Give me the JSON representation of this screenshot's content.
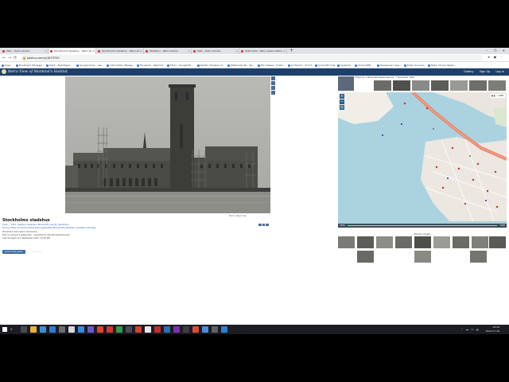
{
  "browser": {
    "tabs": [
      {
        "label": "Main - Retro photos"
      },
      {
        "label": "Stockholms stadshus - Retro ph..."
      },
      {
        "label": "Stockholms stadshus - Retro ph..."
      },
      {
        "label": "Stadshus - Retro photos"
      },
      {
        "label": "Main - Retro photos"
      },
      {
        "label": "Wikimedia - Retro pastvu Retro..."
      }
    ],
    "new_tab_symbol": "+",
    "window_controls": "– ❐ ✕",
    "url": "pastvu.com/p/1673709",
    "back_symbol": "←",
    "forward_symbol": "→",
    "reload_symbol": "⟳",
    "bookmarks": [
      {
        "label": "Apps"
      },
      {
        "label": "Bookmark Manager"
      },
      {
        "label": "SALP - MyVirtgeh..."
      },
      {
        "label": "Google Drive - rea..."
      },
      {
        "label": "Information Manag..."
      },
      {
        "label": "Facebook - Retrolot..."
      },
      {
        "label": "Flickr - Google Ph..."
      },
      {
        "label": "PastVu Timeline (Y..."
      },
      {
        "label": "Wikimedia Ru - Str..."
      },
      {
        "label": "WC Viewer - If Stor..."
      },
      {
        "label": "ArchiCom - Find T..."
      },
      {
        "label": "SumeriTC Hub"
      },
      {
        "label": "Systema"
      },
      {
        "label": "AndroidHD"
      },
      {
        "label": "Нацпроект вод..."
      },
      {
        "label": "Enter Sources..."
      },
      {
        "label": "Data, Choice Weba..."
      }
    ]
  },
  "site": {
    "title": "Retro View of Mankind's Habitat",
    "menu": [
      "Gallery",
      "Sign Up",
      "Log In"
    ]
  },
  "photo": {
    "credit": "Stock. Album Yes",
    "title": "Stockholms stadshus",
    "lines": [
      "1910 — 1911, Sweden, Svealand, Stockholm County, Stockholm",
      "Source: https://commons.wikimedia.org/wiki/File:Stockholms_stadshus_outdated_1910.jpg",
      "Stockholm dzhunskim, stockholm",
      "Text on picture is watermark · uploaded by Zaneta Kamkachauza",
      "Last changed at 3 September 2021, 10:55 PM"
    ],
    "button_label": "Link to this photo",
    "dots": "• • • • •"
  },
  "added": {
    "text": "Added by  ≡  Вячеслав Карамчевская · 1 November 2016"
  },
  "map": {
    "tools": "▣ ◧ ⌕ 1988",
    "bottom_left": "1826",
    "bottom_right": "2000"
  },
  "nearby": {
    "title": "Nearby images"
  },
  "taskbar": {
    "search_symbol": "⌕",
    "time": "18:08",
    "date": "2022-07-28",
    "tray": "⌃ ☁ ▭ 🔈"
  }
}
